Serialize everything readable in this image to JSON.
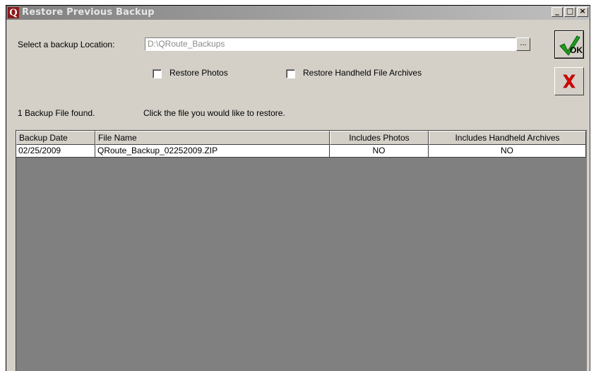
{
  "window": {
    "title": "Restore Previous Backup",
    "app_icon_letter": "Q",
    "caption_buttons": {
      "minimize": "_",
      "maximize": "□",
      "close": "×"
    }
  },
  "location": {
    "label": "Select a backup Location:",
    "value": "D:\\QRoute_Backups",
    "browse_label": "..."
  },
  "options": {
    "restore_photos": {
      "label": "Restore Photos",
      "checked": false
    },
    "restore_handheld": {
      "label": "Restore Handheld File Archives",
      "checked": false
    }
  },
  "buttons": {
    "ok_label": "OK",
    "ok_icon": "checkmark-icon",
    "cancel_icon": "red-x-icon"
  },
  "status": {
    "found_text": "1 Backup File found.",
    "instruction_text": "Click the file you would like to restore."
  },
  "table": {
    "columns": [
      "Backup Date",
      "File Name",
      "Includes Photos",
      "Includes Handheld Archives"
    ],
    "rows": [
      [
        "02/25/2009",
        "QRoute_Backup_02252009.ZIP",
        "NO",
        "NO"
      ]
    ]
  },
  "colors": {
    "ok_check": "#1f9d1f",
    "cancel_x": "#e00000",
    "grid_empty": "#808080",
    "titlebar": "#808080"
  }
}
